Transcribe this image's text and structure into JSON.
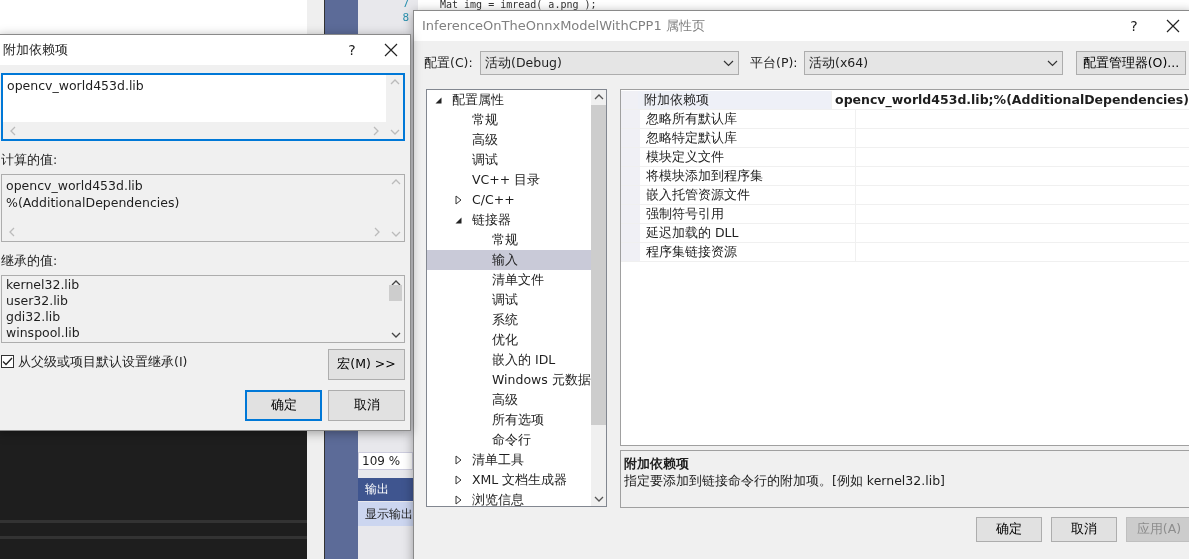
{
  "background": {
    "line_numbers": [
      "7",
      "8"
    ],
    "code_line": "Mat img = imread( a.png );",
    "zoom": "109 %",
    "output_title": "输出",
    "output_toolbar": "显示输出"
  },
  "dependencies_dialog": {
    "title": "附加依赖项",
    "help": "?",
    "edit_lines": [
      "opencv_world453d.lib"
    ],
    "evaluated_label": "计算的值:",
    "evaluated_lines": [
      "opencv_world453d.lib",
      "%(AdditionalDependencies)"
    ],
    "inherited_label": "继承的值:",
    "inherited_lines": [
      "kernel32.lib",
      "user32.lib",
      "gdi32.lib",
      "winspool.lib"
    ],
    "inherit": {
      "label": "从父级或项目默认设置继承(I)",
      "checked": true
    },
    "macros_button": "宏(M) >>",
    "buttons": [
      {
        "label": "确定",
        "default": true
      },
      {
        "label": "取消",
        "default": false
      }
    ]
  },
  "property_pages": {
    "title": "InferenceOnTheOnnxModelWithCPP1 属性页",
    "help": "?",
    "configuration": {
      "label": "配置(C):",
      "value": "活动(Debug)"
    },
    "platform": {
      "label": "平台(P):",
      "value": "活动(x64)"
    },
    "manager_button": "配置管理器(O)...",
    "tree": [
      {
        "label": "配置属性",
        "selected": false,
        "expanded": true,
        "children": [
          {
            "label": "常规",
            "selected": false
          },
          {
            "label": "高级",
            "selected": false
          },
          {
            "label": "调试",
            "selected": false
          },
          {
            "label": "VC++ 目录",
            "selected": false
          },
          {
            "label": "C/C++",
            "selected": false,
            "expanded": false
          },
          {
            "label": "链接器",
            "selected": false,
            "expanded": true,
            "children": [
              {
                "label": "常规",
                "selected": false
              },
              {
                "label": "输入",
                "selected": true
              },
              {
                "label": "清单文件",
                "selected": false
              },
              {
                "label": "调试",
                "selected": false
              },
              {
                "label": "系统",
                "selected": false
              },
              {
                "label": "优化",
                "selected": false
              },
              {
                "label": "嵌入的 IDL",
                "selected": false
              },
              {
                "label": "Windows 元数据",
                "selected": false
              },
              {
                "label": "高级",
                "selected": false
              },
              {
                "label": "所有选项",
                "selected": false
              },
              {
                "label": "命令行",
                "selected": false
              }
            ]
          },
          {
            "label": "清单工具",
            "selected": false,
            "expanded": false
          },
          {
            "label": "XML 文档生成器",
            "selected": false,
            "expanded": false
          },
          {
            "label": "浏览信息",
            "selected": false,
            "expanded": false
          }
        ]
      }
    ],
    "properties": [
      {
        "name": "附加依赖项",
        "value": "opencv_world453d.lib;%(AdditionalDependencies)",
        "selected": true
      },
      {
        "name": "忽略所有默认库",
        "selected": false
      },
      {
        "name": "忽略特定默认库",
        "selected": false
      },
      {
        "name": "模块定义文件",
        "selected": false
      },
      {
        "name": "将模块添加到程序集",
        "selected": false
      },
      {
        "name": "嵌入托管资源文件",
        "selected": false
      },
      {
        "name": "强制符号引用",
        "selected": false
      },
      {
        "name": "延迟加载的 DLL",
        "selected": false
      },
      {
        "name": "程序集链接资源",
        "selected": false
      }
    ],
    "description": {
      "title": "附加依赖项",
      "text": "指定要添加到链接命令行的附加项。[例如 kernel32.lib]"
    },
    "buttons": [
      {
        "label": "确定",
        "disabled": false
      },
      {
        "label": "取消",
        "disabled": false
      },
      {
        "label": "应用(A)",
        "disabled": true
      }
    ]
  }
}
